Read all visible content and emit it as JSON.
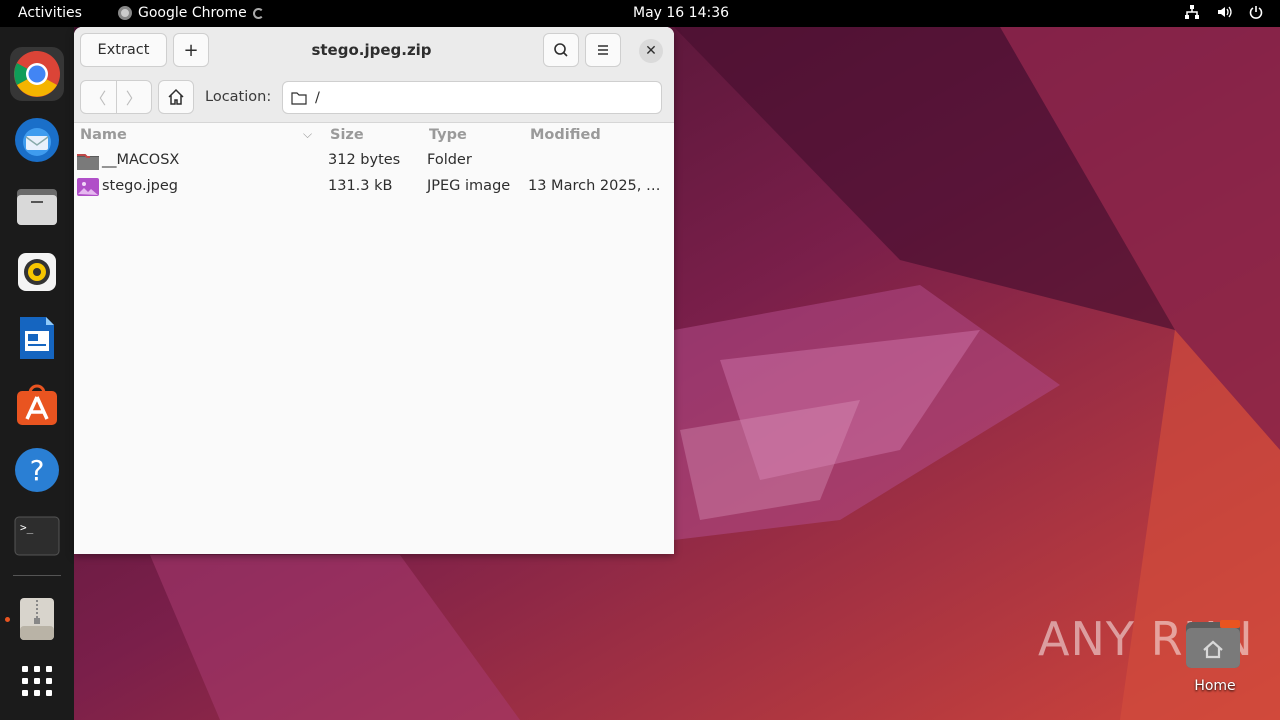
{
  "topbar": {
    "activities": "Activities",
    "app_name": "Google Chrome",
    "clock": "May 16  14:36"
  },
  "dock": {
    "items": [
      "chrome-icon",
      "thunderbird-icon",
      "files-icon",
      "rhythmbox-icon",
      "writer-icon",
      "app-center-icon",
      "help-icon",
      "terminal-icon",
      "archive-manager-icon",
      "show-apps-icon"
    ]
  },
  "window": {
    "title": "stego.jpeg.zip",
    "extract_label": "Extract",
    "add_label": "+",
    "location_label": "Location:",
    "location_value": "/",
    "columns": {
      "name": "Name",
      "size": "Size",
      "type": "Type",
      "modified": "Modified"
    },
    "rows": [
      {
        "name": "__MACOSX",
        "size": "312 bytes",
        "type": "Folder",
        "modified": "",
        "icon": "folder-icon"
      },
      {
        "name": "stego.jpeg",
        "size": "131.3 kB",
        "type": "JPEG image",
        "modified": "13 March 2025, …",
        "icon": "image-file-icon"
      }
    ]
  },
  "desktop": {
    "home_label": "Home"
  },
  "watermark": "ANY RUN",
  "colors": {
    "accent": "#e95420",
    "topbar": "#000000",
    "dock": "#1b1b1b"
  }
}
